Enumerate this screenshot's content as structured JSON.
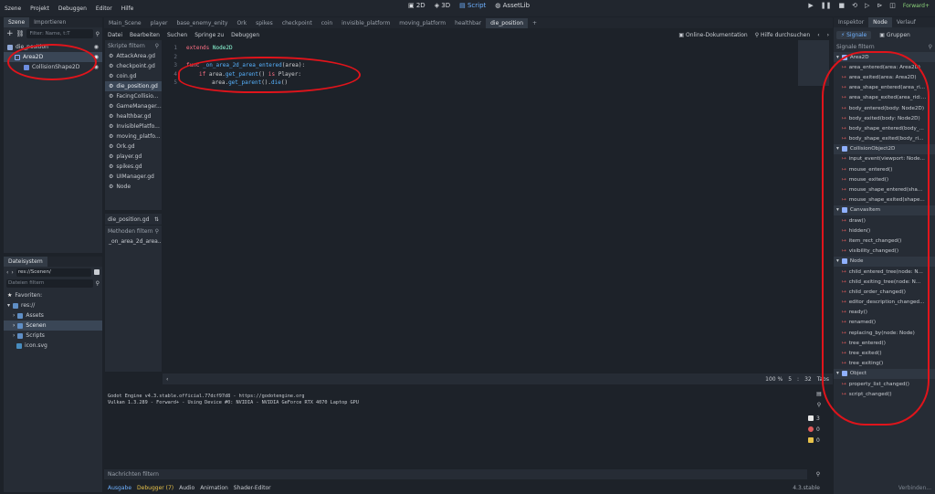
{
  "menu": [
    "Szene",
    "Projekt",
    "Debuggen",
    "Editor",
    "Hilfe"
  ],
  "main_switch": [
    "2D",
    "3D",
    "Script",
    "AssetLib"
  ],
  "renderer": "Forward+",
  "scene_tabs": [
    "Szene",
    "Importieren"
  ],
  "scene_filter": "Filter: Name, t:T",
  "scene_tree": {
    "root": "die_position",
    "child": "Area2D",
    "grandchild": "CollisionShape2D"
  },
  "filesystem": {
    "title": "Dateisystem",
    "path": "res://Scenen/",
    "filter": "Dateien filtern",
    "items": [
      "Favoriten:",
      "res://",
      "Assets",
      "Scenen",
      "Scripts",
      "icon.svg"
    ]
  },
  "editor_tabs": [
    "Main_Scene",
    "player",
    "base_enemy_enity",
    "Ork",
    "spikes",
    "checkpoint",
    "coin",
    "invisible_platform",
    "moving_platform",
    "healthbar",
    "die_position"
  ],
  "script_menu": [
    "Datei",
    "Bearbeiten",
    "Suchen",
    "Springe zu",
    "Debuggen"
  ],
  "script_links": [
    "Online-Dokumentation",
    "Hilfe durchsuchen"
  ],
  "scripts_filter": "Skripte filtern",
  "scripts": [
    "AttackArea.gd",
    "checkpoint.gd",
    "coin.gd",
    "die_position.gd",
    "FacingCollisio...",
    "GameManager...",
    "healthbar.gd",
    "InvisiblePlatfo...",
    "moving_platfo...",
    "Ork.gd",
    "player.gd",
    "spikes.gd",
    "UIManager.gd",
    "Node"
  ],
  "current_script": "die_position.gd",
  "methods_filter": "Methoden filtern",
  "methods": [
    "_on_area_2d_area..."
  ],
  "code_lines": [
    {
      "n": "1",
      "parts": [
        [
          "kw",
          "extends "
        ],
        [
          "ty",
          "Node2D"
        ]
      ]
    },
    {
      "n": "2",
      "parts": []
    },
    {
      "n": "3",
      "parts": [
        [
          "kw",
          "func "
        ],
        [
          "fn",
          "_on_area_2d_area_entered"
        ],
        [
          "tx",
          "(area):"
        ]
      ]
    },
    {
      "n": "4",
      "parts": [
        [
          "kw",
          "if "
        ],
        [
          "tx",
          "area."
        ],
        [
          "fn",
          "get_parent"
        ],
        [
          "tx",
          "() "
        ],
        [
          "kw",
          "is "
        ],
        [
          "tx",
          "Player:"
        ]
      ]
    },
    {
      "n": "5",
      "parts": [
        [
          "tx",
          "area."
        ],
        [
          "fn",
          "get_parent"
        ],
        [
          "tx",
          "()."
        ],
        [
          "fn",
          "die"
        ],
        [
          "tx",
          "()"
        ]
      ]
    }
  ],
  "status": {
    "zoom": "100 %",
    "line": "5",
    "col": "32",
    "indent": "Tabs"
  },
  "output": [
    "Godot Engine v4.3.stable.official.77dcf97d8 - https://godotengine.org",
    "Vulkan 1.3.289 - Forward+ - Using Device #0: NVIDIA - NVIDIA GeForce RTX 4070 Laptop GPU"
  ],
  "output_counts": [
    "3",
    "0",
    "0"
  ],
  "messages_filter": "Nachrichten filtern",
  "bottom_tabs": [
    "Ausgabe",
    "Debugger (7)",
    "Audio",
    "Animation",
    "Shader-Editor"
  ],
  "version": "4.3.stable",
  "right_tabs": [
    "Inspektor",
    "Node",
    "Verlauf"
  ],
  "signal_tabs": [
    "Signale",
    "Gruppen"
  ],
  "signals_filter": "Signale filtern",
  "signal_groups": [
    {
      "name": "Area2D",
      "items": [
        "area_entered(area: Area2D)",
        "area_exited(area: Area2D)",
        "area_shape_entered(area_ri...",
        "area_shape_exited(area_rid:...",
        "body_entered(body: Node2D)",
        "body_exited(body: Node2D)",
        "body_shape_entered(body_...",
        "body_shape_exited(body_ri..."
      ]
    },
    {
      "name": "CollisionObject2D",
      "items": [
        "input_event(viewport: Node...",
        "mouse_entered()",
        "mouse_exited()",
        "mouse_shape_entered(sha...",
        "mouse_shape_exited(shape..."
      ]
    },
    {
      "name": "CanvasItem",
      "items": [
        "draw()",
        "hidden()",
        "item_rect_changed()",
        "visibility_changed()"
      ]
    },
    {
      "name": "Node",
      "items": [
        "child_entered_tree(node: N...",
        "child_exiting_tree(node: N...",
        "child_order_changed()",
        "editor_description_changed...",
        "ready()",
        "renamed()",
        "replacing_by(node: Node)",
        "tree_entered()",
        "tree_exited()",
        "tree_exiting()"
      ]
    },
    {
      "name": "Object",
      "items": [
        "property_list_changed()",
        "script_changed()"
      ]
    }
  ],
  "connect_button": "Verbinden..."
}
